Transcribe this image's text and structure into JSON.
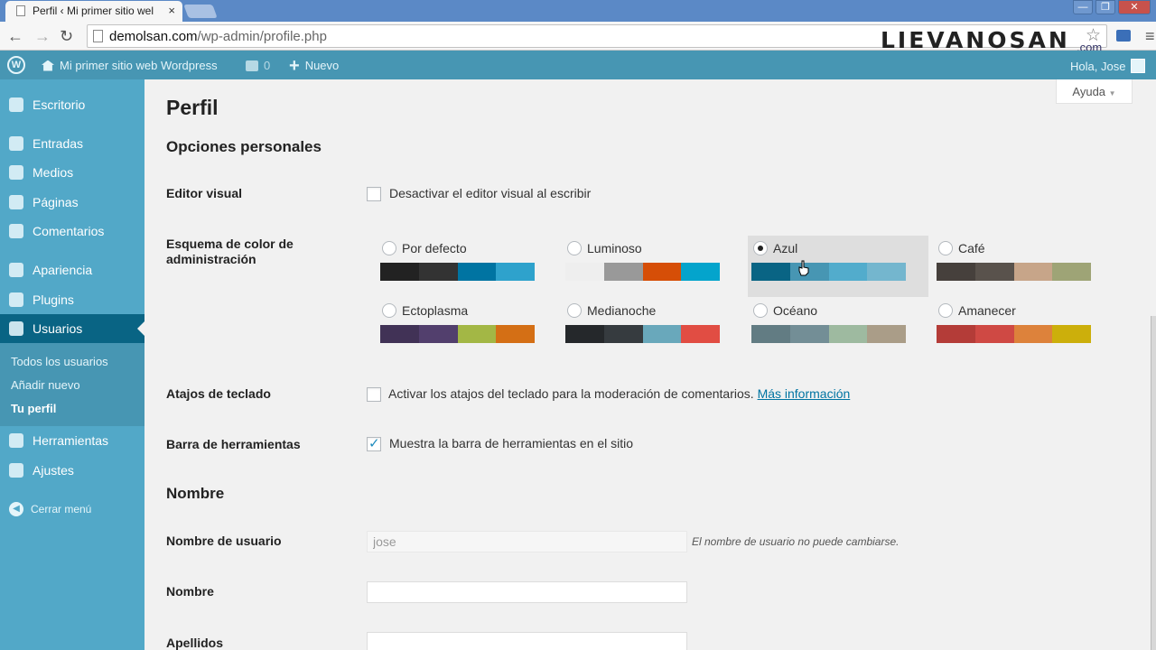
{
  "browser": {
    "tab_title": "Perfil ‹ Mi primer sitio wel",
    "tab_close": "×",
    "url_host": "demolsan.com",
    "url_path": "/wp-admin/profile.php",
    "watermark": "LIEVANOSAN",
    "watermark_suffix": ".com",
    "window_controls": [
      "—",
      "❐",
      "✕"
    ]
  },
  "adminbar": {
    "site_name": "Mi primer sitio web Wordpress",
    "comments_count": "0",
    "new_label": "Nuevo",
    "greeting": "Hola, Jose"
  },
  "sidebar": {
    "items": [
      {
        "label": "Escritorio",
        "icon": "dashboard-icon"
      },
      {
        "label": "Entradas",
        "icon": "pin-icon"
      },
      {
        "label": "Medios",
        "icon": "media-icon"
      },
      {
        "label": "Páginas",
        "icon": "pages-icon"
      },
      {
        "label": "Comentarios",
        "icon": "comments-icon"
      },
      {
        "label": "Apariencia",
        "icon": "brush-icon"
      },
      {
        "label": "Plugins",
        "icon": "plugin-icon"
      },
      {
        "label": "Usuarios",
        "icon": "users-icon"
      },
      {
        "label": "Herramientas",
        "icon": "tools-icon"
      },
      {
        "label": "Ajustes",
        "icon": "settings-icon"
      }
    ],
    "submenu": [
      "Todos los usuarios",
      "Añadir nuevo",
      "Tu perfil"
    ],
    "collapse_label": "Cerrar menú"
  },
  "help_label": "Ayuda",
  "page": {
    "title": "Perfil",
    "section_personal": "Opciones personales",
    "section_name": "Nombre",
    "visual_editor": {
      "label": "Editor visual",
      "text": "Desactivar el editor visual al escribir",
      "checked": false
    },
    "color_scheme": {
      "label": "Esquema de color de administración",
      "selected": "Azul",
      "schemes": [
        {
          "name": "Por defecto",
          "colors": [
            "#222222",
            "#333333",
            "#0074a2",
            "#2ea2cc"
          ]
        },
        {
          "name": "Luminoso",
          "colors": [
            "#eeeeee",
            "#999999",
            "#d64e07",
            "#04a4cc"
          ]
        },
        {
          "name": "Azul",
          "colors": [
            "#096484",
            "#4796b3",
            "#52accc",
            "#74b6ce"
          ]
        },
        {
          "name": "Café",
          "colors": [
            "#46403c",
            "#59524c",
            "#c7a589",
            "#9ea476"
          ]
        },
        {
          "name": "Ectoplasma",
          "colors": [
            "#413256",
            "#523f6d",
            "#a3b745",
            "#d46f15"
          ]
        },
        {
          "name": "Medianoche",
          "colors": [
            "#25282b",
            "#363b3f",
            "#69a8bb",
            "#e14d43"
          ]
        },
        {
          "name": "Océano",
          "colors": [
            "#627c83",
            "#738e96",
            "#9ebaa0",
            "#aa9d88"
          ]
        },
        {
          "name": "Amanecer",
          "colors": [
            "#b43c38",
            "#cf4944",
            "#dd823b",
            "#ccaf0b"
          ]
        }
      ]
    },
    "keyboard_shortcuts": {
      "label": "Atajos de teclado",
      "text": "Activar los atajos del teclado para la moderación de comentarios.",
      "link": "Más información",
      "checked": false
    },
    "toolbar": {
      "label": "Barra de herramientas",
      "text": "Muestra la barra de herramientas en el sitio",
      "checked": true
    },
    "username": {
      "label": "Nombre de usuario",
      "value": "jose",
      "description": "El nombre de usuario no puede cambiarse."
    },
    "first_name": {
      "label": "Nombre",
      "value": ""
    },
    "last_name": {
      "label": "Apellidos",
      "value": ""
    }
  }
}
